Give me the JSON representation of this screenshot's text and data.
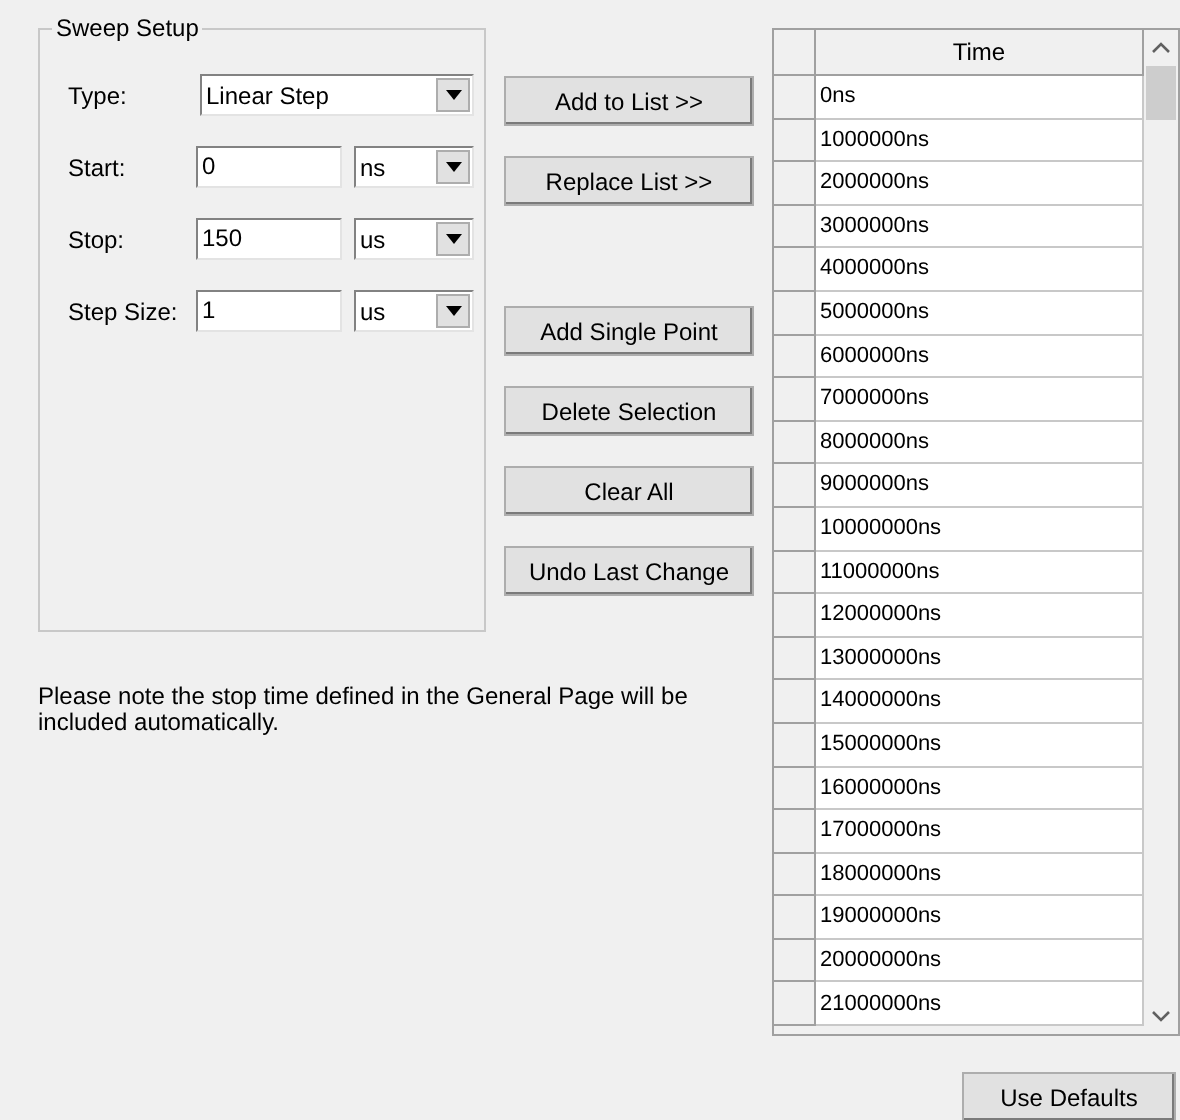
{
  "sweep_setup": {
    "title": "Sweep Setup",
    "fields": [
      {
        "label": "Type:",
        "kind": "dropdown",
        "value": "Linear Step"
      },
      {
        "label": "Start:",
        "kind": "value_unit",
        "value": "0",
        "unit": "ns"
      },
      {
        "label": "Stop:",
        "kind": "value_unit",
        "value": "150",
        "unit": "us"
      },
      {
        "label": "Step Size:",
        "kind": "value_unit",
        "value": "1",
        "unit": "us"
      }
    ]
  },
  "note": "Please note the stop time defined in the General Page will be included automatically.",
  "list_buttons": [
    "Add to List >>",
    "Replace List >>"
  ],
  "edit_buttons": [
    "Add Single Point",
    "Delete Selection",
    "Clear All",
    "Undo Last Change"
  ],
  "table": {
    "columns": [
      "Time"
    ],
    "rows": [
      "0ns",
      "1000000ns",
      "2000000ns",
      "3000000ns",
      "4000000ns",
      "5000000ns",
      "6000000ns",
      "7000000ns",
      "8000000ns",
      "9000000ns",
      "10000000ns",
      "11000000ns",
      "12000000ns",
      "13000000ns",
      "14000000ns",
      "15000000ns",
      "16000000ns",
      "17000000ns",
      "18000000ns",
      "19000000ns",
      "20000000ns",
      "21000000ns"
    ]
  },
  "footer_button": "Use Defaults"
}
